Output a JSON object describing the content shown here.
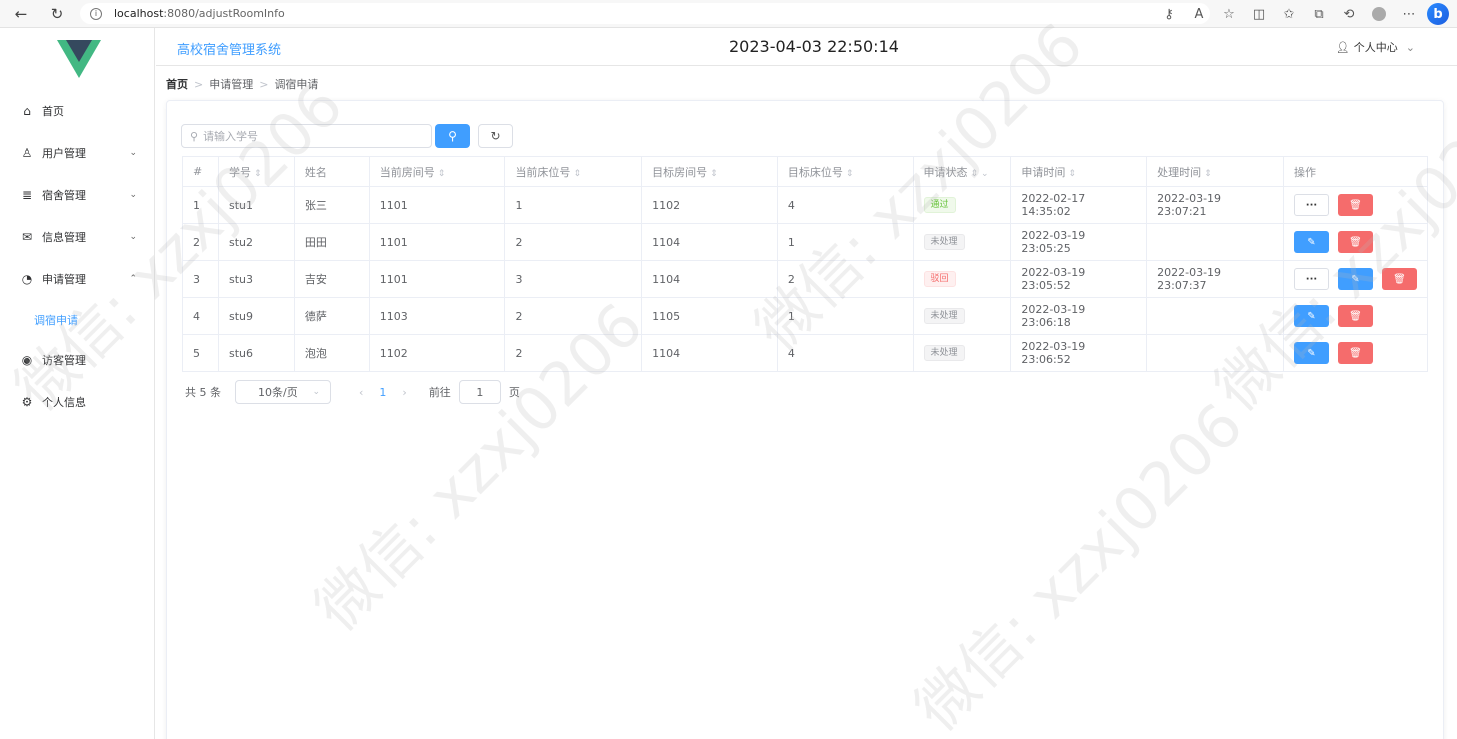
{
  "browser": {
    "url_host": "localhost",
    "url_path": ":8080/adjustRoomInfo"
  },
  "header": {
    "system_title": "高校宿舍管理系统",
    "datetime": "2023-04-03 22:50:14",
    "user_center": "个人中心"
  },
  "sidebar": {
    "items": [
      {
        "label": "首页",
        "icon": "home-icon"
      },
      {
        "label": "用户管理",
        "icon": "user-icon"
      },
      {
        "label": "宿舍管理",
        "icon": "database-icon"
      },
      {
        "label": "信息管理",
        "icon": "mail-icon"
      },
      {
        "label": "申请管理",
        "icon": "pie-chart-icon"
      },
      {
        "label": "访客管理",
        "icon": "eye-icon"
      },
      {
        "label": "个人信息",
        "icon": "settings-icon"
      }
    ],
    "subitem": "调宿申请"
  },
  "breadcrumb": [
    "首页",
    "申请管理",
    "调宿申请"
  ],
  "search": {
    "placeholder": "请输入学号"
  },
  "table": {
    "columns": [
      "#",
      "学号",
      "姓名",
      "当前房间号",
      "当前床位号",
      "目标房间号",
      "目标床位号",
      "申请状态",
      "申请时间",
      "处理时间",
      "操作"
    ],
    "rows": [
      {
        "idx": "1",
        "sid": "stu1",
        "name": "张三",
        "cur_room": "1101",
        "cur_bed": "1",
        "tgt_room": "1102",
        "tgt_bed": "4",
        "status": "通过",
        "apply_time": "2022-02-17 14:35:02",
        "handle_time": "2022-03-19 23:07:21"
      },
      {
        "idx": "2",
        "sid": "stu2",
        "name": "田田",
        "cur_room": "1101",
        "cur_bed": "2",
        "tgt_room": "1104",
        "tgt_bed": "1",
        "status": "未处理",
        "apply_time": "2022-03-19 23:05:25",
        "handle_time": ""
      },
      {
        "idx": "3",
        "sid": "stu3",
        "name": "吉安",
        "cur_room": "1101",
        "cur_bed": "3",
        "tgt_room": "1104",
        "tgt_bed": "2",
        "status": "驳回",
        "apply_time": "2022-03-19 23:05:52",
        "handle_time": "2022-03-19 23:07:37"
      },
      {
        "idx": "4",
        "sid": "stu9",
        "name": "德萨",
        "cur_room": "1103",
        "cur_bed": "2",
        "tgt_room": "1105",
        "tgt_bed": "1",
        "status": "未处理",
        "apply_time": "2022-03-19 23:06:18",
        "handle_time": ""
      },
      {
        "idx": "5",
        "sid": "stu6",
        "name": "泡泡",
        "cur_room": "1102",
        "cur_bed": "2",
        "tgt_room": "1104",
        "tgt_bed": "4",
        "status": "未处理",
        "apply_time": "2022-03-19 23:06:52",
        "handle_time": ""
      }
    ]
  },
  "pagination": {
    "total": "共 5 条",
    "page_size": "10条/页",
    "current": "1",
    "goto_label": "前往",
    "goto_value": "1",
    "page_suffix": "页"
  },
  "watermark": "微信: xzxj0206",
  "colors": {
    "primary": "#409eff",
    "danger": "#f56c6c",
    "success": "#67c23a",
    "vue_green": "#42b883",
    "vue_dark": "#35495e"
  }
}
